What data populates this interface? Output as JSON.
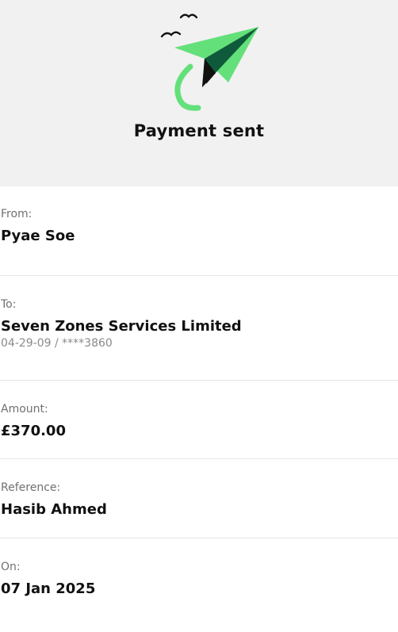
{
  "header": {
    "title": "Payment sent",
    "illustration_icon": "paper-plane-icon",
    "colors": {
      "background": "#f1f1f1",
      "plane_light": "#63e07a",
      "plane_dark": "#0f5a3a"
    }
  },
  "details": {
    "from": {
      "label": "From:",
      "value": "Pyae Soe"
    },
    "to": {
      "label": "To:",
      "value": "Seven Zones Services Limited",
      "account": "04-29-09 / ****3860"
    },
    "amount": {
      "label": "Amount:",
      "value": "£370.00"
    },
    "reference": {
      "label": "Reference:",
      "value": "Hasib Ahmed"
    },
    "on": {
      "label": "On:",
      "value": "07 Jan 2025"
    }
  }
}
